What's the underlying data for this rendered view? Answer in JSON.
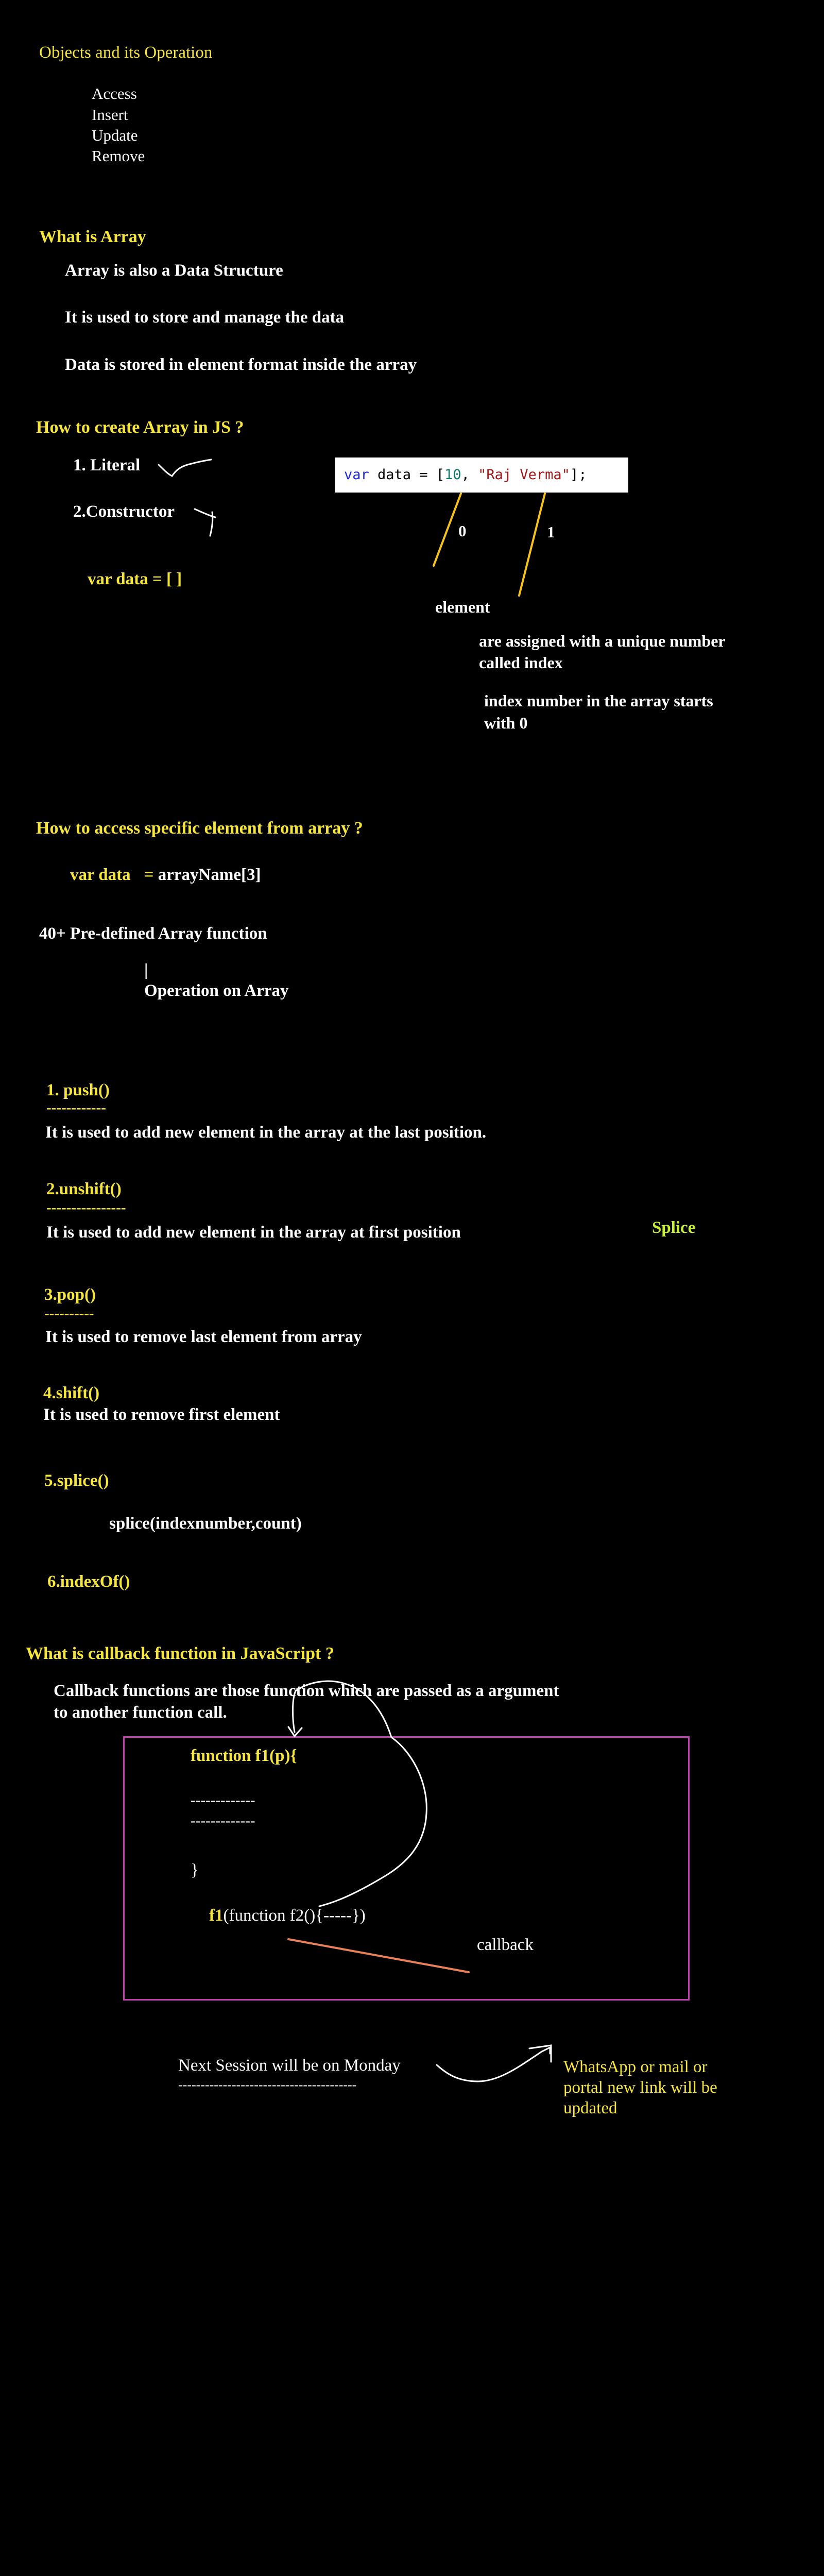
{
  "colors": {
    "heading": "#f6e53c",
    "text": "#ffffff",
    "accent_green": "#c7f032",
    "box_border": "#c040b0",
    "code_bg": "#ffffff"
  },
  "intro": {
    "title": "Objects and its Operation",
    "operations": [
      "Access",
      "Insert",
      "Update",
      "Remove"
    ]
  },
  "what_is_array": {
    "heading": "What is Array",
    "lines": [
      "Array is also a Data Structure",
      "It is used to store and manage the data",
      "Data is stored in element format inside the array"
    ]
  },
  "create_array": {
    "heading": "How to create Array in JS ?",
    "literal": "1. Literal",
    "constructor": "2.Constructor",
    "var_example": "var data = [  ]",
    "code": {
      "kw": "var",
      "name": " data = [",
      "n1": "10",
      "sep": ", ",
      "s1": "\"Raj Verma\"",
      "end": "];"
    },
    "index0": "0",
    "index1": "1",
    "element_label": "element",
    "note1": "are assigned with a unique number",
    "note2": "called index",
    "note3": "index number in the array starts",
    "note4": "with 0"
  },
  "access": {
    "heading": "How to access specific element from array ?",
    "example_var": "var data",
    "example_eq": "=",
    "example_expr": "arrayName[3]",
    "predefined": "40+ Pre-defined Array function",
    "bar": "|",
    "operation": "Operation on Array"
  },
  "functions": {
    "push": {
      "title": "1. push()",
      "underline": "------------",
      "desc": "It is used to add new element in the array at the last position."
    },
    "unshift": {
      "title": "2.unshift()",
      "underline": "----------------",
      "desc": "It is used to add new element in the array at first position"
    },
    "splice_note": "Splice",
    "pop": {
      "title": "3.pop()",
      "underline": "----------",
      "desc": "It is used to remove last element from array"
    },
    "shift": {
      "title": "4.shift()",
      "desc": "It is used to remove first element"
    },
    "splice": {
      "title": "5.splice()",
      "desc": "splice(indexnumber,count)"
    },
    "indexof": {
      "title": "6.indexOf()"
    }
  },
  "callback": {
    "heading": "What is callback function in JavaScript ?",
    "line1": "Callback functions are those function which are passed as a argument",
    "line2": "to another function call.",
    "fn_decl": "function f1(",
    "fn_param": "p",
    "fn_close": "){",
    "dash1": "-------------",
    "dash2": "-------------",
    "brace": "}",
    "call_name": "f1",
    "call_rest": "(function f2(){-----})",
    "callback_label": "callback"
  },
  "footer": {
    "next_session": "Next Session will be on Monday",
    "underline": "----------------------------------------",
    "note1": "WhatsApp or mail or",
    "note2": "portal new link will be",
    "note3": "updated"
  }
}
